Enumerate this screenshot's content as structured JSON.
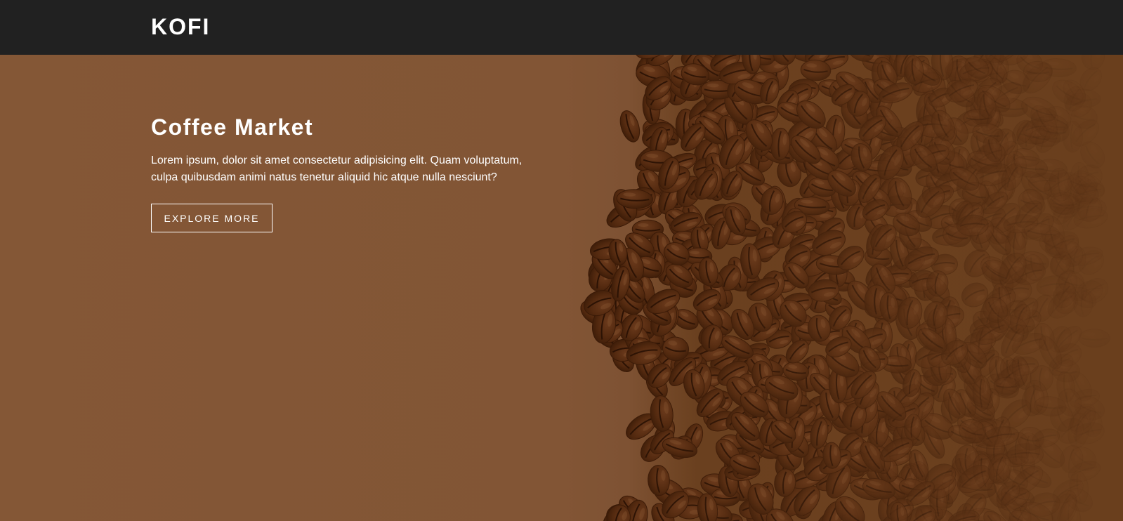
{
  "navbar": {
    "brand": "KOFI"
  },
  "hero": {
    "title": "Coffee Market",
    "text": "Lorem ipsum, dolor sit amet consectetur adipisicing elit. Quam voluptatum, culpa quibusdam animi natus tenetur aliquid hic atque nulla nesciunt?",
    "button_label": "EXPLORE MORE"
  },
  "colors": {
    "navbar_bg": "#212121",
    "hero_bg": "#845736",
    "bean_dark": "#4e2a12",
    "text": "#ffffff"
  }
}
